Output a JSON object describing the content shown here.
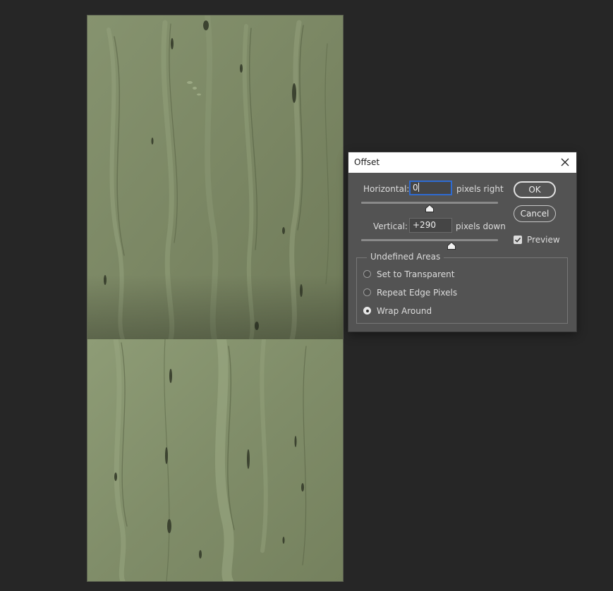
{
  "dialog": {
    "title": "Offset",
    "horizontal": {
      "label": "Horizontal:",
      "value": "0",
      "unit": "pixels right",
      "slider_position": 0.5
    },
    "vertical": {
      "label": "Vertical:",
      "value": "+290",
      "unit": "pixels down",
      "slider_position": 0.66
    },
    "ok_label": "OK",
    "cancel_label": "Cancel",
    "preview": {
      "label": "Preview",
      "checked": true
    },
    "undefined_areas": {
      "title": "Undefined Areas",
      "options": [
        {
          "label": "Set to Transparent",
          "checked": false
        },
        {
          "label": "Repeat Edge Pixels",
          "checked": false
        },
        {
          "label": "Wrap Around",
          "checked": true
        }
      ]
    }
  },
  "colors": {
    "workspace_bg": "#262626",
    "dialog_bg": "#535353",
    "texture_base": "#7e8a68",
    "focus_accent": "#2e6bd1"
  },
  "icons": {
    "close": "close-icon",
    "checkbox": "checkmark-icon",
    "slider_thumb": "slider-thumb-icon"
  }
}
